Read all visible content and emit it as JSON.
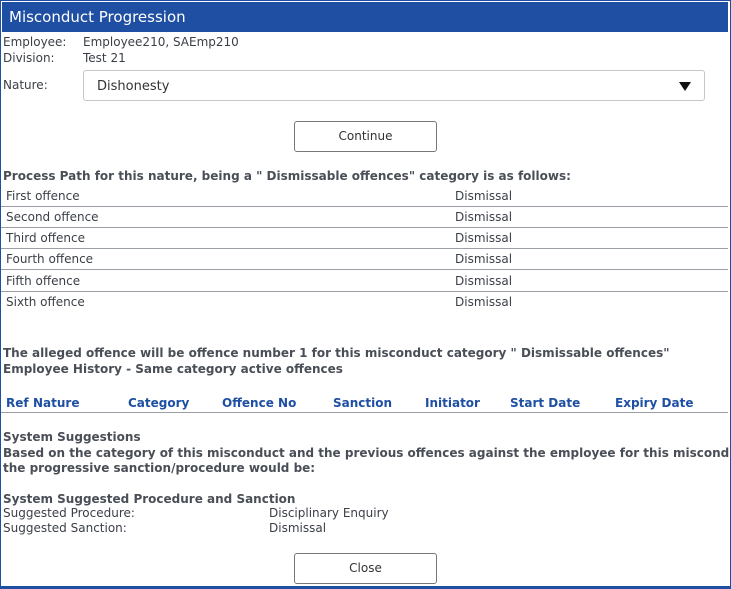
{
  "window": {
    "title": "Misconduct Progression"
  },
  "employee": {
    "employee_label": "Employee:",
    "employee_value": "Employee210, SAEmp210",
    "division_label": "Division:",
    "division_value": "Test 21",
    "nature_label": "Nature:",
    "nature_value": "Dishonesty"
  },
  "buttons": {
    "continue": "Continue",
    "close": "Close"
  },
  "process_path": {
    "heading": "Process Path for this nature, being a \" Dismissable offences\" category is as follows:",
    "rows": [
      {
        "offence": "First offence",
        "sanction": "Dismissal"
      },
      {
        "offence": "Second offence",
        "sanction": "Dismissal"
      },
      {
        "offence": "Third offence",
        "sanction": "Dismissal"
      },
      {
        "offence": "Fourth offence",
        "sanction": "Dismissal"
      },
      {
        "offence": "Fifth offence",
        "sanction": "Dismissal"
      },
      {
        "offence": "Sixth offence",
        "sanction": "Dismissal"
      }
    ]
  },
  "alleged": {
    "line1": "The alleged offence will be offence number 1 for this misconduct category \" Dismissable offences\"",
    "line2": "Employee History - Same category active offences"
  },
  "history_table": {
    "columns": [
      "Ref",
      "Nature",
      "Category",
      "Offence No",
      "Sanction",
      "Initiator",
      "Start Date",
      "Expiry Date"
    ]
  },
  "suggestions": {
    "heading": "System Suggestions",
    "text_line1": "Based on the category of this misconduct and the previous offences against the employee for this misconduct category,",
    "text_line2": "the progressive sanction/procedure would be:",
    "procedure_heading": "System Suggested Procedure and Sanction",
    "procedure_label": "Suggested Procedure:",
    "procedure_value": "Disciplinary Enquiry",
    "sanction_label": "Suggested Sanction:",
    "sanction_value": "Dismissal"
  },
  "colors": {
    "accent": "#1e4fa3",
    "text": "#3a3f47",
    "divider": "#9aa0a6"
  }
}
